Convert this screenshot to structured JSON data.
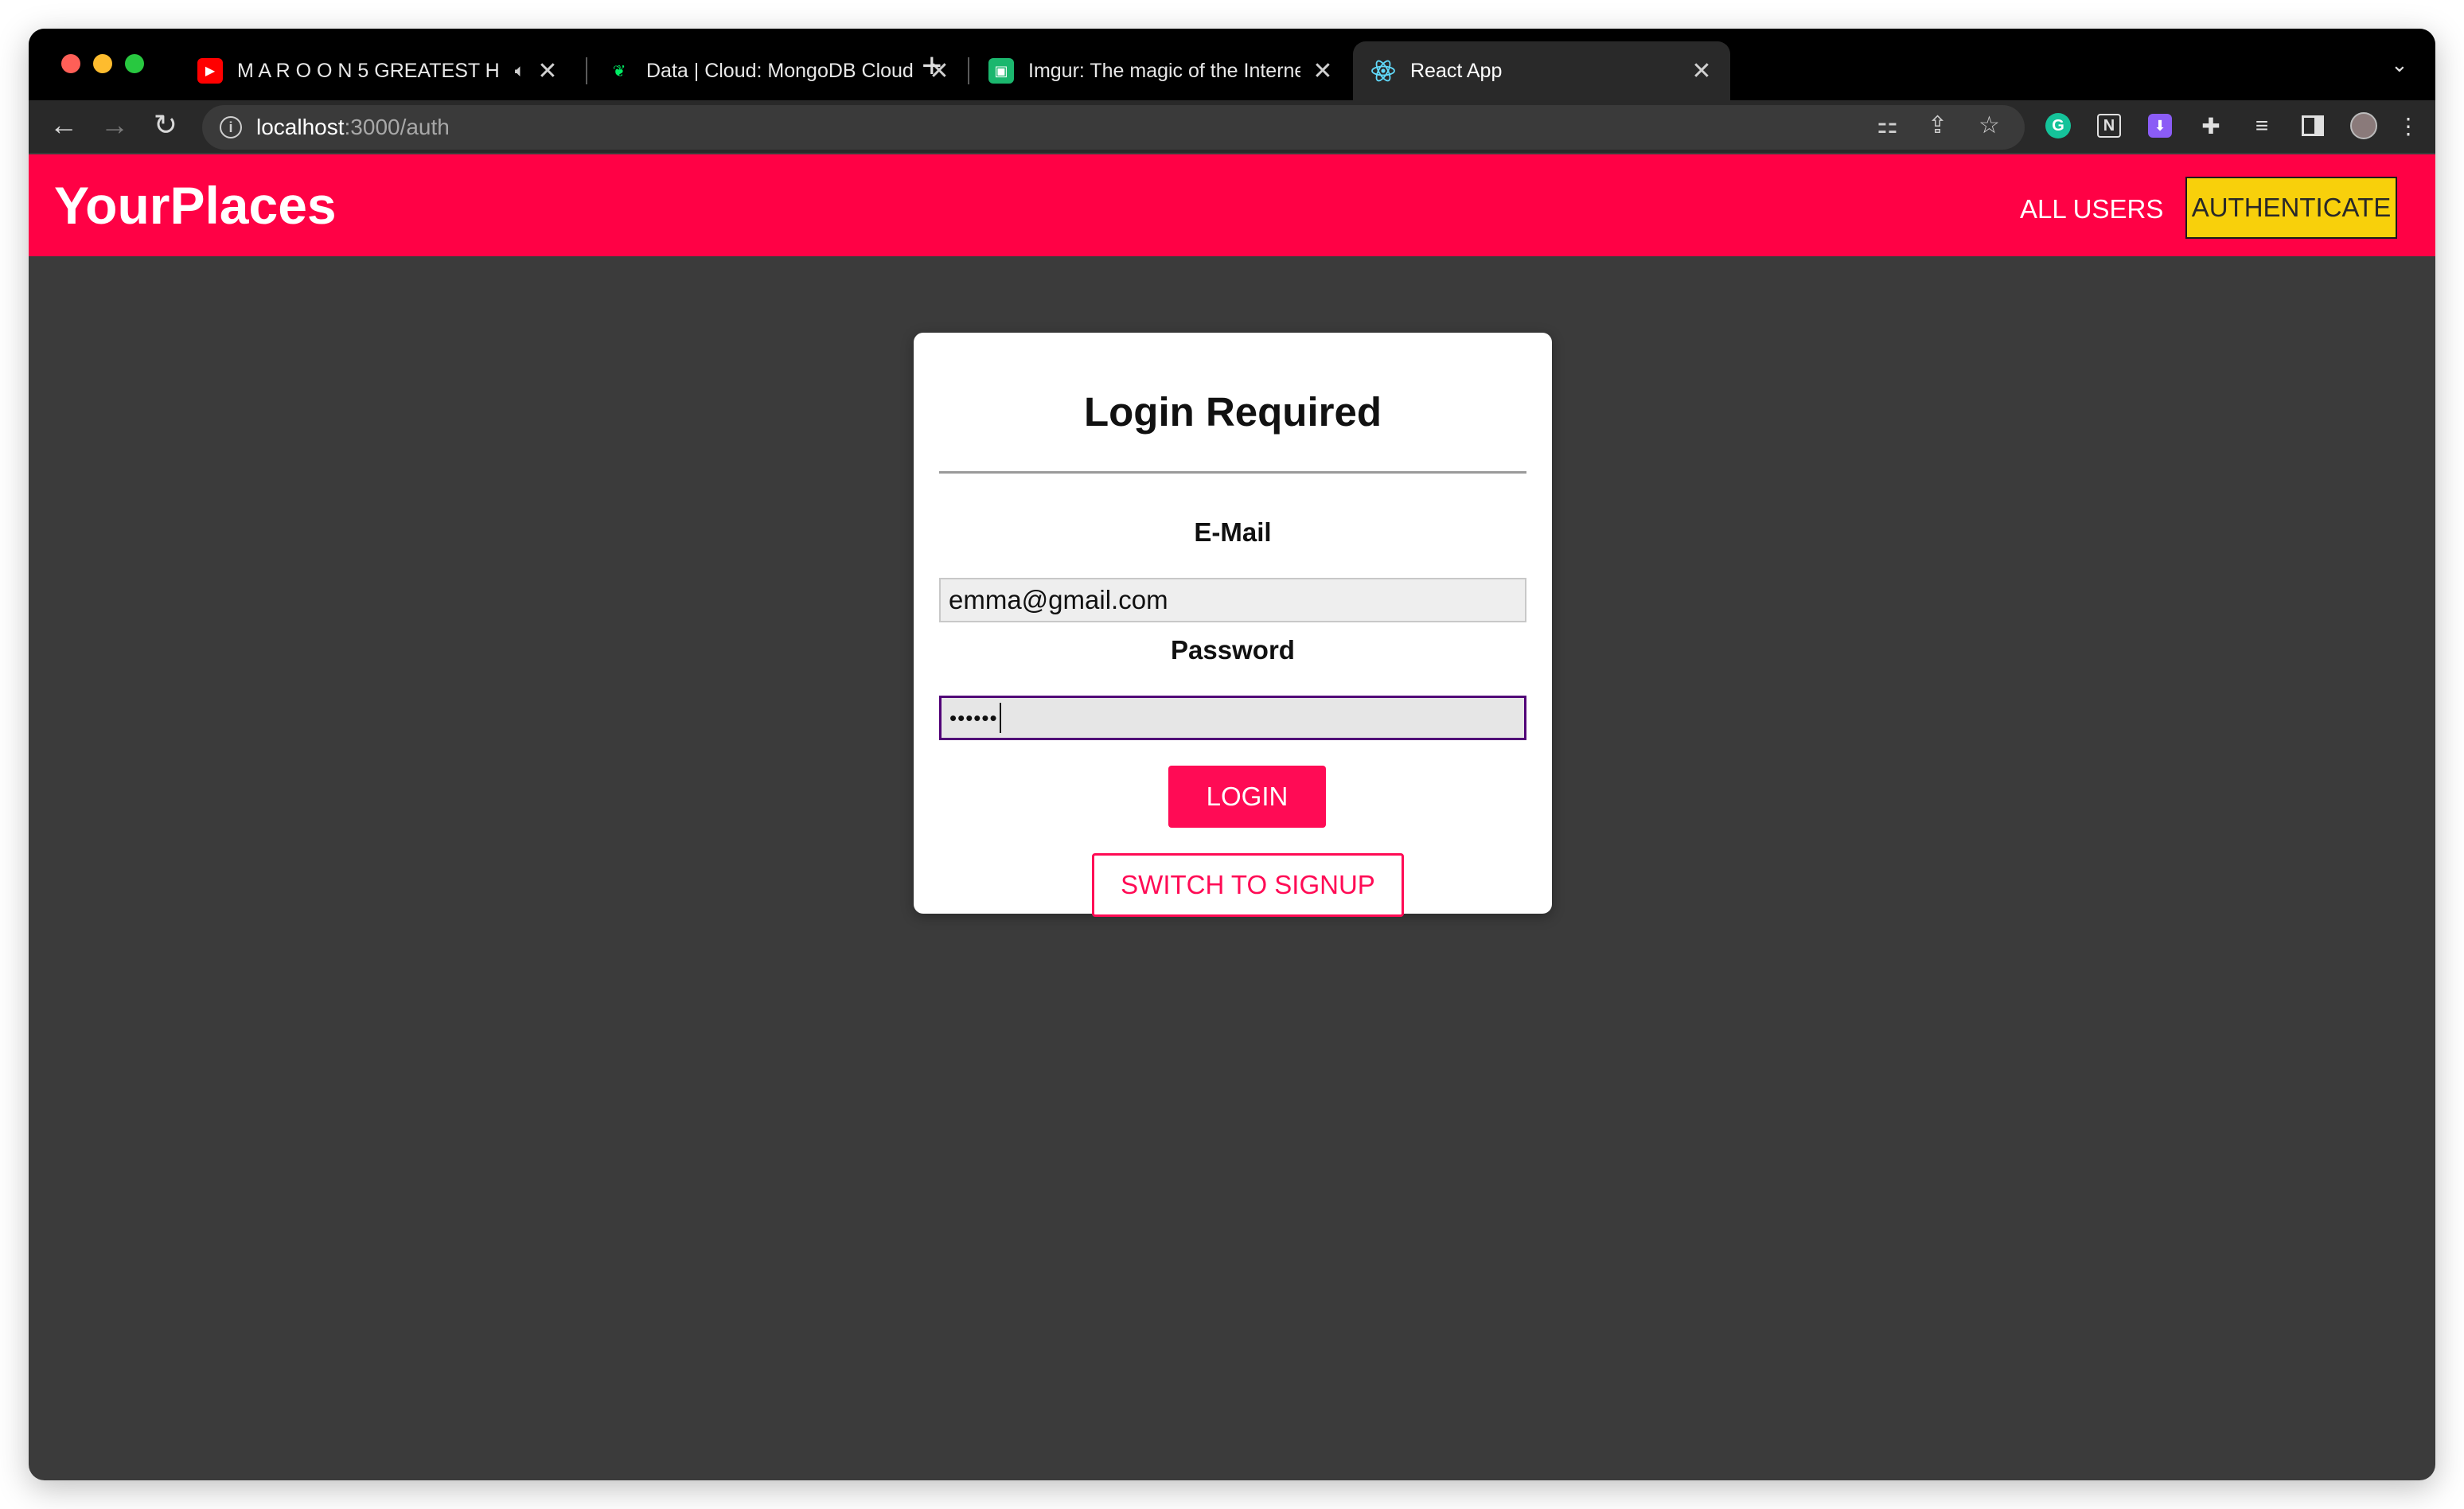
{
  "browser": {
    "tabs": [
      {
        "title": "M A R O O N 5 GREATEST H",
        "favicon": "youtube-icon",
        "audio": true
      },
      {
        "title": "Data | Cloud: MongoDB Cloud",
        "favicon": "mongodb-leaf-icon"
      },
      {
        "title": "Imgur: The magic of the Interne",
        "favicon": "imgur-icon"
      },
      {
        "title": "React App",
        "favicon": "react-icon",
        "active": true
      }
    ],
    "url_host": "localhost",
    "url_path": ":3000/auth"
  },
  "app": {
    "brand": "YourPlaces",
    "nav": {
      "all_users": "ALL USERS",
      "authenticate": "AUTHENTICATE"
    },
    "colors": {
      "primary": "#ff0145",
      "accent": "#f8d00b",
      "background": "#3b3b3b"
    }
  },
  "auth": {
    "title": "Login Required",
    "email_label": "E-Mail",
    "email_value": "emma@gmail.com",
    "password_label": "Password",
    "password_value": "••••••",
    "login_button": "LOGIN",
    "switch_button": "SWITCH TO SIGNUP"
  }
}
